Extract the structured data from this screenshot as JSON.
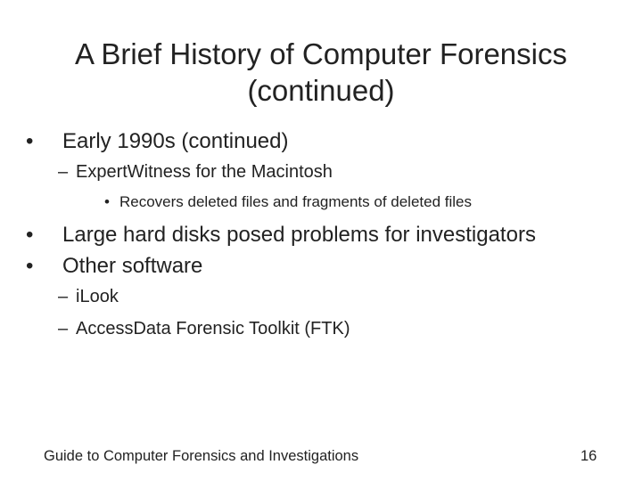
{
  "slide": {
    "title_line1": "A Brief History of Computer Forensics",
    "title_line2": "(continued)",
    "bullets": [
      {
        "level": 1,
        "marker": "•",
        "text": "Early 1990s (continued)"
      },
      {
        "level": 2,
        "marker": "–",
        "text": "ExpertWitness for the Macintosh"
      },
      {
        "level": 3,
        "marker": "•",
        "text": "Recovers deleted files and fragments of deleted files"
      },
      {
        "level": 1,
        "marker": "•",
        "text": "Large hard disks posed problems for investigators"
      },
      {
        "level": 1,
        "marker": "•",
        "text": "Other software"
      },
      {
        "level": 2,
        "marker": "–",
        "text": "iLook"
      },
      {
        "level": 2,
        "marker": "–",
        "text": "AccessData Forensic Toolkit (FTK)"
      }
    ],
    "footer_text": "Guide to Computer Forensics and Investigations",
    "page_number": "16"
  }
}
